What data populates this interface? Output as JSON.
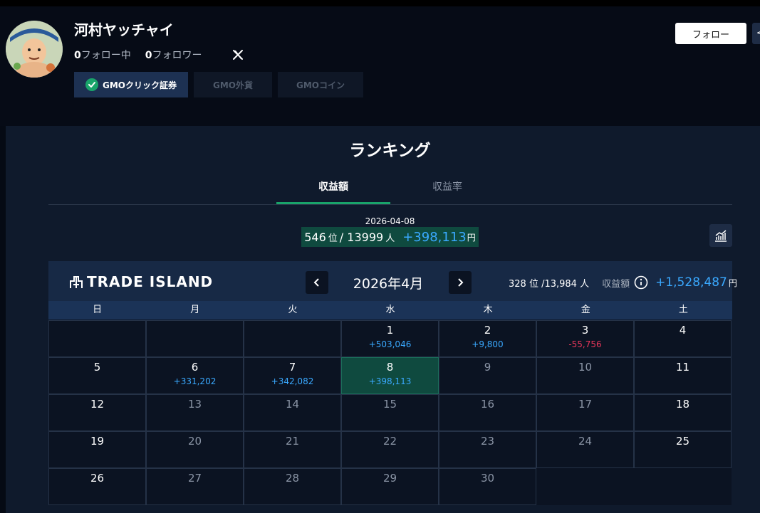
{
  "profile": {
    "username": "河村ヤッチャイ",
    "following_count": "0",
    "following_label": "フォロー中",
    "followers_count": "0",
    "followers_label": "フォロワー",
    "follow_button": "フォロー",
    "brokers": [
      "GMOクリック証券",
      "GMO外貨",
      "GMOコイン"
    ]
  },
  "ranking": {
    "title": "ランキング",
    "tabs": [
      "収益額",
      "収益率"
    ],
    "date": "2026-04-08",
    "rank": "546",
    "rank_unit": "位",
    "total": "13999",
    "total_unit": "人",
    "profit": "+398,113",
    "profit_unit": "円"
  },
  "calendar": {
    "logo": "TRADE ISLAND",
    "month": "2026年4月",
    "stats_rank": "328 位 /13,984 人",
    "stats_label": "収益額",
    "stats_total": "+1,528,487",
    "stats_unit": "円",
    "weekdays": [
      "日",
      "月",
      "火",
      "水",
      "木",
      "金",
      "土"
    ],
    "days": [
      {
        "day": "",
        "amount": ""
      },
      {
        "day": "",
        "amount": ""
      },
      {
        "day": "",
        "amount": ""
      },
      {
        "day": "1",
        "amount": "+503,046",
        "sign": "pos"
      },
      {
        "day": "2",
        "amount": "+9,800",
        "sign": "pos"
      },
      {
        "day": "3",
        "amount": "-55,756",
        "sign": "neg"
      },
      {
        "day": "4",
        "amount": ""
      },
      {
        "day": "5",
        "amount": ""
      },
      {
        "day": "6",
        "amount": "+331,202",
        "sign": "pos"
      },
      {
        "day": "7",
        "amount": "+342,082",
        "sign": "pos"
      },
      {
        "day": "8",
        "amount": "+398,113",
        "sign": "pos",
        "today": true
      },
      {
        "day": "9",
        "amount": "",
        "dim": true
      },
      {
        "day": "10",
        "amount": "",
        "dim": true
      },
      {
        "day": "11",
        "amount": ""
      },
      {
        "day": "12",
        "amount": ""
      },
      {
        "day": "13",
        "amount": "",
        "dim": true
      },
      {
        "day": "14",
        "amount": "",
        "dim": true
      },
      {
        "day": "15",
        "amount": "",
        "dim": true
      },
      {
        "day": "16",
        "amount": "",
        "dim": true
      },
      {
        "day": "17",
        "amount": "",
        "dim": true
      },
      {
        "day": "18",
        "amount": ""
      },
      {
        "day": "19",
        "amount": ""
      },
      {
        "day": "20",
        "amount": "",
        "dim": true
      },
      {
        "day": "21",
        "amount": "",
        "dim": true
      },
      {
        "day": "22",
        "amount": "",
        "dim": true
      },
      {
        "day": "23",
        "amount": "",
        "dim": true
      },
      {
        "day": "24",
        "amount": "",
        "dim": true
      },
      {
        "day": "25",
        "amount": ""
      },
      {
        "day": "26",
        "amount": ""
      },
      {
        "day": "27",
        "amount": "",
        "dim": true
      },
      {
        "day": "28",
        "amount": "",
        "dim": true
      },
      {
        "day": "29",
        "amount": "",
        "dim": true
      },
      {
        "day": "30",
        "amount": "",
        "dim": true
      },
      {
        "day": "",
        "amount": "",
        "end": true
      },
      {
        "day": "",
        "amount": "",
        "end": true
      }
    ]
  },
  "colors": {
    "accent_green": "#19a46a",
    "positive": "#3aa9ff",
    "negative": "#e8365a",
    "today_bg": "#0f4a3f"
  }
}
